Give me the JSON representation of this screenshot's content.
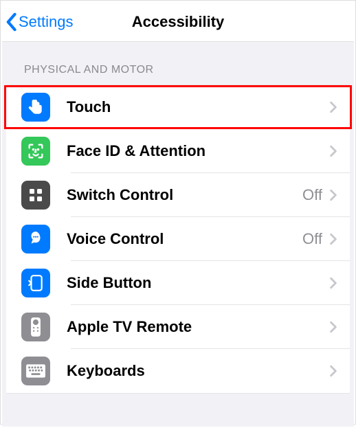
{
  "nav": {
    "back_label": "Settings",
    "title": "Accessibility"
  },
  "section": {
    "header": "PHYSICAL AND MOTOR",
    "items": [
      {
        "icon": "touch",
        "icon_bg": "blue",
        "label": "Touch",
        "detail": "",
        "highlighted": true
      },
      {
        "icon": "faceid",
        "icon_bg": "green",
        "label": "Face ID & Attention",
        "detail": "",
        "highlighted": false
      },
      {
        "icon": "switch",
        "icon_bg": "darkgray",
        "label": "Switch Control",
        "detail": "Off",
        "highlighted": false
      },
      {
        "icon": "voice",
        "icon_bg": "blue",
        "label": "Voice Control",
        "detail": "Off",
        "highlighted": false
      },
      {
        "icon": "sidebutton",
        "icon_bg": "blue",
        "label": "Side Button",
        "detail": "",
        "highlighted": false
      },
      {
        "icon": "appletv",
        "icon_bg": "gray",
        "label": "Apple TV Remote",
        "detail": "",
        "highlighted": false
      },
      {
        "icon": "keyboard",
        "icon_bg": "gray",
        "label": "Keyboards",
        "detail": "",
        "highlighted": false
      }
    ]
  }
}
